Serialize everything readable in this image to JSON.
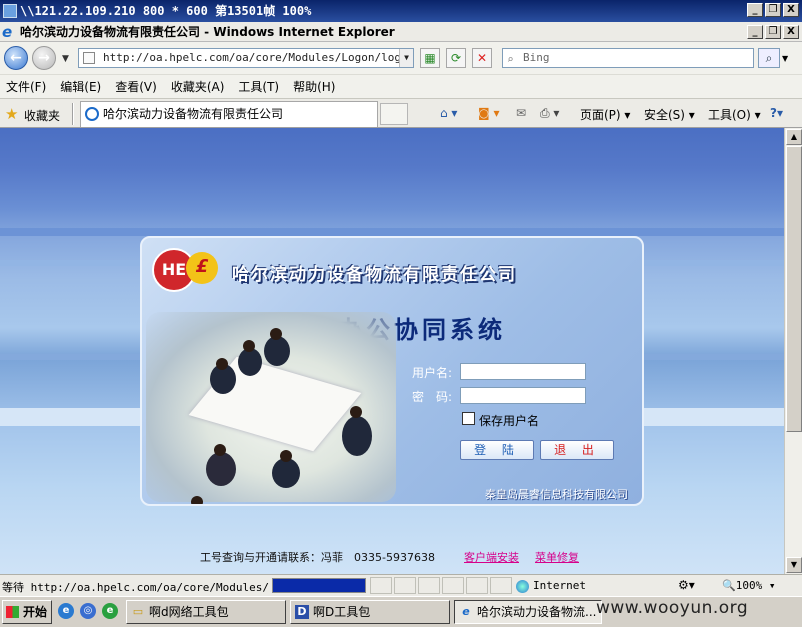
{
  "rdp": {
    "title": "\\\\121.22.109.210 800 * 600 第13501帧 100%",
    "min": "_",
    "restore": "❐",
    "close": "X"
  },
  "browser": {
    "title": "哈尔滨动力设备物流有限责任公司 - Windows Internet Explorer",
    "address": "http://oa.hpelc.com/oa/core/Modules/Logon/logon.a",
    "search_placeholder": "Bing",
    "menu": [
      "文件(F)",
      "编辑(E)",
      "查看(V)",
      "收藏夹(A)",
      "工具(T)",
      "帮助(H)"
    ],
    "favorites_label": "收藏夹",
    "tab_title": "哈尔滨动力设备物流有限责任公司",
    "commands": [
      "页面(P)",
      "安全(S)",
      "工具(O)"
    ],
    "status_text": "等待 http://oa.hpelc.com/oa/core/Modules/Logon/logon.aspx",
    "progress": 1.0,
    "zone": "Internet",
    "zoom": "100%"
  },
  "login": {
    "logo_left": "HE",
    "logo_right": "£",
    "company": "哈尔滨动力设备物流有限责任公司",
    "system": "办公协同系统",
    "username_label": "用户名:",
    "password_label": "密　码:",
    "remember_label": "保存用户名",
    "login_button": "登 陆",
    "exit_button": "退 出",
    "vendor": "秦皇岛晨睿信息科技有限公司",
    "contact": "工号查询与开通请联系：冯菲　0335-5937638",
    "client_install": "客户端安装",
    "menu_repair": "菜单修复"
  },
  "taskbar": {
    "start": "开始",
    "items": [
      "啊d网络工具包",
      "啊D工具包",
      "哈尔滨动力设备物流..."
    ],
    "watermark": "www.wooyun.org"
  }
}
